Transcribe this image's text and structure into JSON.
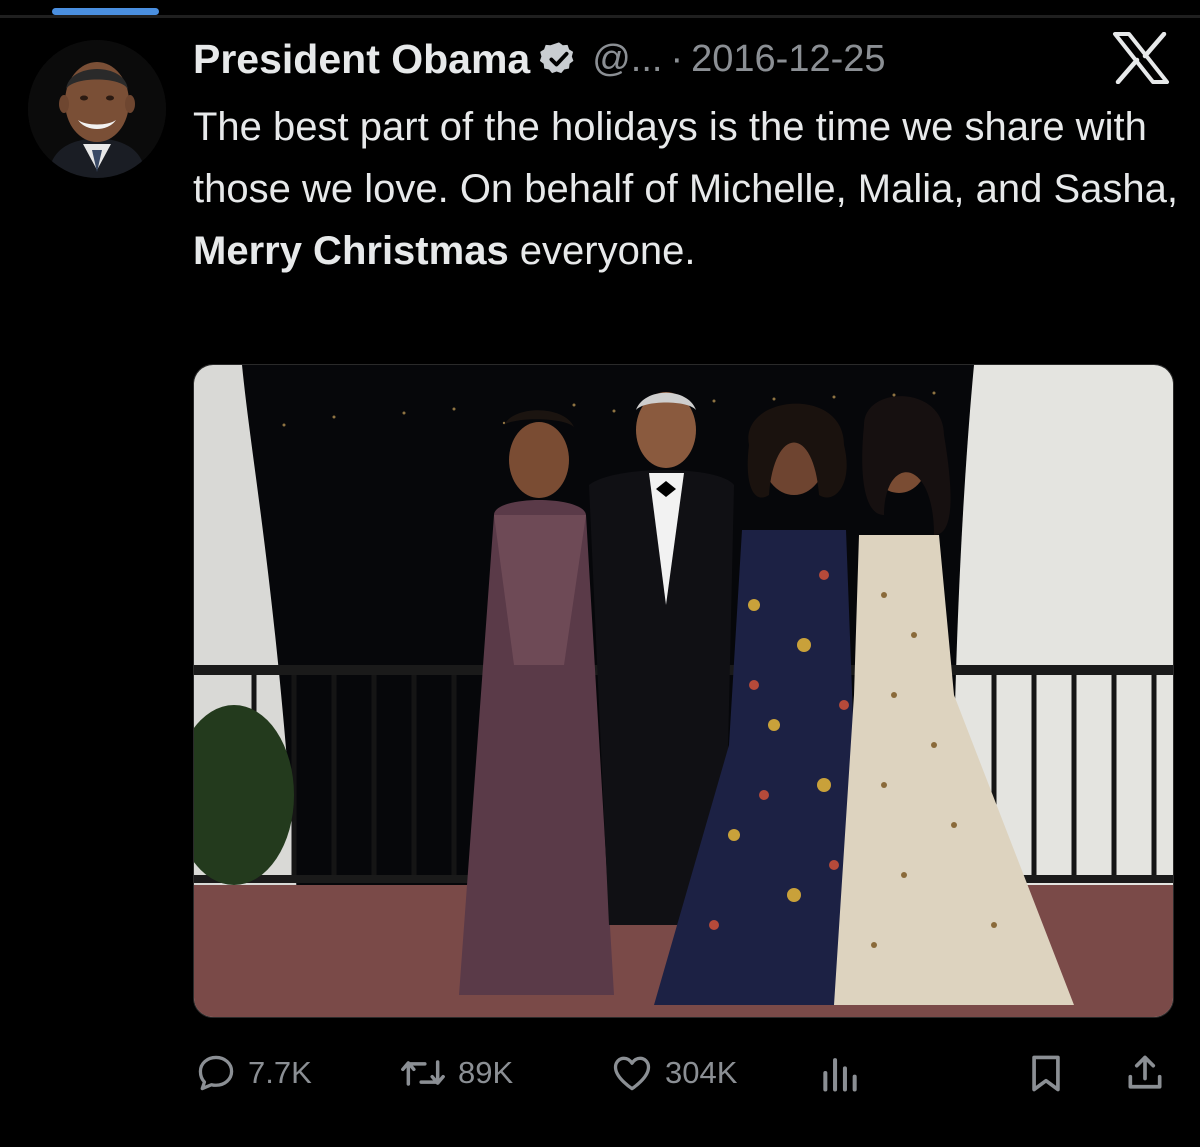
{
  "tweet": {
    "author_name": "President Obama",
    "handle": "@...",
    "separator": "·",
    "date": "2016-12-25",
    "text_part1": "The best part of the holidays is the time we share with those we love. On behalf of Michelle, Malia, and Sasha, ",
    "text_bold": "Merry Christmas",
    "text_part2": " everyone."
  },
  "actions": {
    "replies": "7.7K",
    "retweets": "89K",
    "likes": "304K"
  },
  "icons": {
    "verified": "verified-badge-icon",
    "platform": "x-logo-icon",
    "reply": "reply-icon",
    "retweet": "retweet-icon",
    "like": "heart-icon",
    "views": "views-icon",
    "bookmark": "bookmark-icon",
    "share": "share-icon"
  },
  "colors": {
    "background": "#000000",
    "text": "#e7e9ea",
    "muted": "#8b8f94",
    "accent": "#4a8fe0"
  }
}
